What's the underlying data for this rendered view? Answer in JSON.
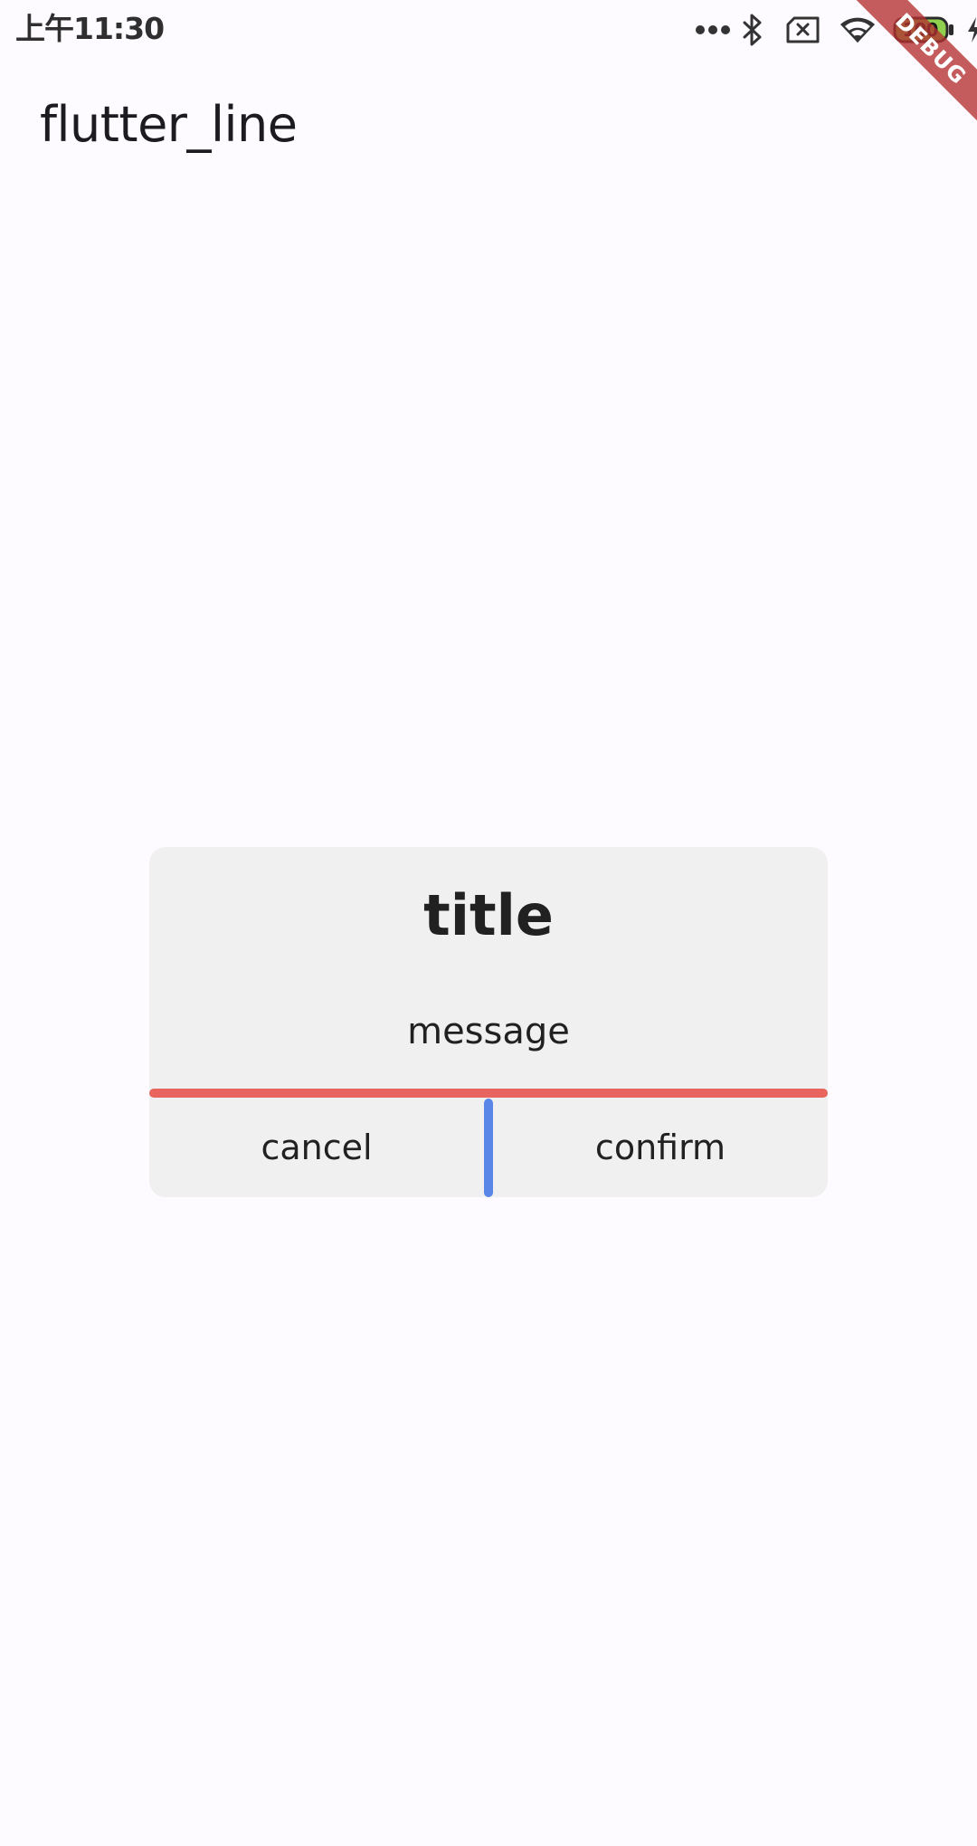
{
  "status_bar": {
    "time": "上午11:30",
    "battery_level": "100",
    "icons": [
      "more-dots-icon",
      "bluetooth-icon",
      "sim-card-x-icon",
      "wifi-icon",
      "battery-icon",
      "charging-bolt-icon"
    ]
  },
  "debug_banner": {
    "label": "DEBUG",
    "color": "#b43030"
  },
  "app_bar": {
    "title": "flutter_line"
  },
  "dialog": {
    "title": "title",
    "message": "message",
    "cancel_label": "cancel",
    "confirm_label": "confirm",
    "background": "#f0f0f0",
    "divider_horizontal_color": "#e8645f",
    "divider_vertical_color": "#5a86e8"
  },
  "colors": {
    "page_background": "#fdfbff",
    "text": "#1c1b1f"
  }
}
